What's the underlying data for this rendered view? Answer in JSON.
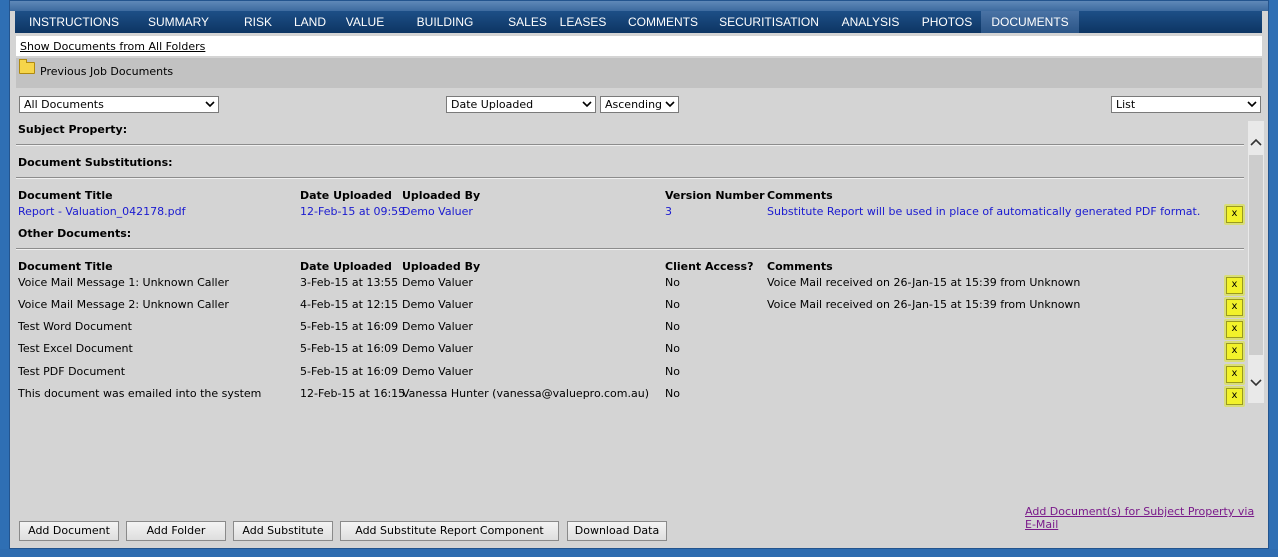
{
  "tabs": [
    {
      "label": "INSTRUCTIONS"
    },
    {
      "label": "SUMMARY"
    },
    {
      "label": "RISK"
    },
    {
      "label": "LAND"
    },
    {
      "label": "VALUE"
    },
    {
      "label": "BUILDING"
    },
    {
      "label": "SALES"
    },
    {
      "label": "LEASES"
    },
    {
      "label": "COMMENTS"
    },
    {
      "label": "SECURITISATION"
    },
    {
      "label": "ANALYSIS"
    },
    {
      "label": "PHOTOS"
    },
    {
      "label": "DOCUMENTS"
    }
  ],
  "active_tab": "DOCUMENTS",
  "show_all_folders": "Show Documents from All Folders",
  "folder_label": "Previous Job Documents",
  "filters": {
    "document_filter": "All Documents",
    "sort_by": "Date Uploaded",
    "sort_order": "Ascending",
    "view_mode": "List"
  },
  "sections": {
    "subject": "Subject Property:",
    "substitutions": "Document Substitutions:",
    "other": "Other Documents:"
  },
  "substitutions_headers": {
    "title": "Document Title",
    "date": "Date Uploaded",
    "by": "Uploaded By",
    "version": "Version Number",
    "comments": "Comments"
  },
  "substitutions_rows": [
    {
      "title": "Report - Valuation_042178.pdf",
      "date": "12-Feb-15 at 09:59",
      "by": "Demo Valuer",
      "version": "3",
      "comments": "Substitute Report will be used in place of automatically generated PDF format.",
      "delete": "x"
    }
  ],
  "other_headers": {
    "title": "Document Title",
    "date": "Date Uploaded",
    "by": "Uploaded By",
    "access": "Client Access?",
    "comments": "Comments"
  },
  "other_rows": [
    {
      "title": "Voice Mail Message 1: Unknown Caller",
      "date": "3-Feb-15 at 13:55",
      "by": "Demo Valuer",
      "access": "No",
      "comments": "Voice Mail received on 26-Jan-15 at 15:39 from Unknown",
      "delete": "x"
    },
    {
      "title": "Voice Mail Message 2: Unknown Caller",
      "date": "4-Feb-15 at 12:15",
      "by": "Demo Valuer",
      "access": "No",
      "comments": "Voice Mail received on 26-Jan-15 at 15:39 from Unknown",
      "delete": "x"
    },
    {
      "title": "Test Word Document",
      "date": "5-Feb-15 at 16:09",
      "by": "Demo Valuer",
      "access": "No",
      "comments": "",
      "delete": "x"
    },
    {
      "title": "Test Excel Document",
      "date": "5-Feb-15 at 16:09",
      "by": "Demo Valuer",
      "access": "No",
      "comments": "",
      "delete": "x"
    },
    {
      "title": "Test PDF Document",
      "date": "5-Feb-15 at 16:09",
      "by": "Demo Valuer",
      "access": "No",
      "comments": "",
      "delete": "x"
    },
    {
      "title": "This document was emailed into the system",
      "date": "12-Feb-15 at 16:15",
      "by": "Vanessa Hunter (vanessa@valuepro.com.au)",
      "access": "No",
      "comments": "",
      "delete": "x"
    }
  ],
  "email_link": "Add Document(s) for Subject Property via E-Mail",
  "buttons": {
    "add_document": "Add Document",
    "add_folder": "Add Folder",
    "add_substitute": "Add Substitute",
    "add_substitute_report": "Add Substitute Report Component",
    "download_data": "Download Data"
  },
  "colors": {
    "tab_bar": "#0d3563",
    "active_tab": "#4a73a5",
    "link_blue": "#1a1ad0",
    "delete_yellow": "#f2f22a",
    "panel_grey": "#d4d4d4"
  }
}
